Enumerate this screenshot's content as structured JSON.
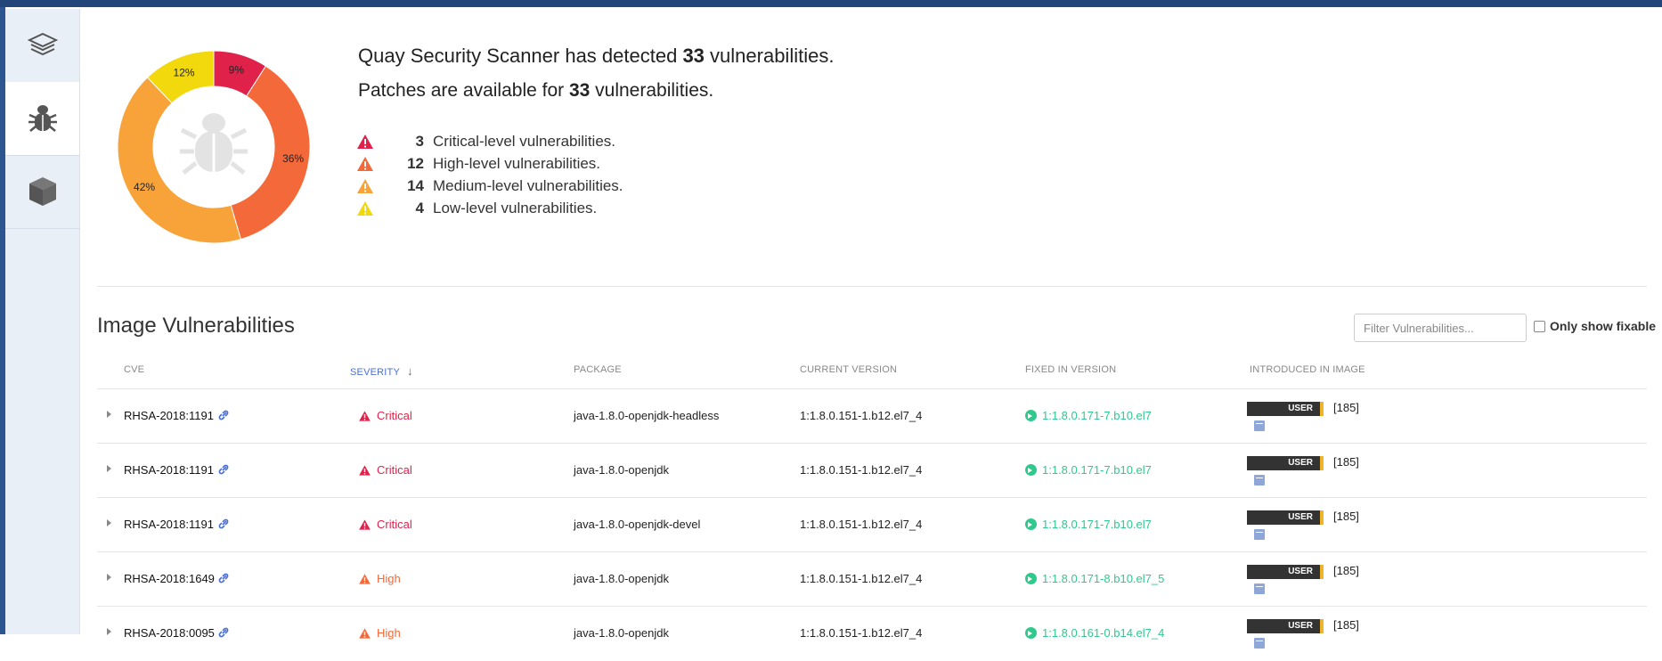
{
  "sidebar": {
    "tabs": [
      {
        "name": "layers",
        "icon": "layers-icon",
        "active": false
      },
      {
        "name": "security",
        "icon": "bug-icon",
        "active": true
      },
      {
        "name": "packages",
        "icon": "package-icon",
        "active": false
      }
    ]
  },
  "summary": {
    "line1_prefix": "Quay Security Scanner has detected ",
    "line1_count": "33",
    "line1_suffix": " vulnerabilities.",
    "line2_prefix": "Patches are available for ",
    "line2_count": "33",
    "line2_suffix": " vulnerabilities.",
    "levels": [
      {
        "count": "3",
        "label": "Critical-level vulnerabilities.",
        "color": "#e0224a"
      },
      {
        "count": "12",
        "label": "High-level vulnerabilities.",
        "color": "#f4693a"
      },
      {
        "count": "14",
        "label": "Medium-level vulnerabilities.",
        "color": "#f8a33a"
      },
      {
        "count": "4",
        "label": "Low-level vulnerabilities.",
        "color": "#f2d90e"
      }
    ]
  },
  "chart_data": {
    "type": "pie",
    "categories": [
      "Critical",
      "High",
      "Medium",
      "Low"
    ],
    "values": [
      3,
      12,
      14,
      4
    ],
    "labels": [
      "9%",
      "36%",
      "42%",
      "12%"
    ],
    "colors": [
      "#e0224a",
      "#f4693a",
      "#f8a33a",
      "#f2d90e"
    ],
    "center_icon": "bug-icon"
  },
  "vulnerabilities": {
    "title": "Image Vulnerabilities",
    "filter_placeholder": "Filter Vulnerabilities...",
    "only_fixable_label": "Only show fixable",
    "columns": [
      "CVE",
      "SEVERITY",
      "PACKAGE",
      "CURRENT VERSION",
      "FIXED IN VERSION",
      "INTRODUCED IN IMAGE"
    ],
    "sort_arrow": "↓",
    "rows": [
      {
        "cve": "RHSA-2018:1191",
        "severity": "Critical",
        "severity_color": "#e0224a",
        "package": "java-1.8.0-openjdk-headless",
        "current": "1:1.8.0.151-1.b12.el7_4",
        "fixed": "1:1.8.0.171-7.b10.el7",
        "badge": "USER",
        "image": "[185]"
      },
      {
        "cve": "RHSA-2018:1191",
        "severity": "Critical",
        "severity_color": "#e0224a",
        "package": "java-1.8.0-openjdk",
        "current": "1:1.8.0.151-1.b12.el7_4",
        "fixed": "1:1.8.0.171-7.b10.el7",
        "badge": "USER",
        "image": "[185]"
      },
      {
        "cve": "RHSA-2018:1191",
        "severity": "Critical",
        "severity_color": "#e0224a",
        "package": "java-1.8.0-openjdk-devel",
        "current": "1:1.8.0.151-1.b12.el7_4",
        "fixed": "1:1.8.0.171-7.b10.el7",
        "badge": "USER",
        "image": "[185]"
      },
      {
        "cve": "RHSA-2018:1649",
        "severity": "High",
        "severity_color": "#f4693a",
        "package": "java-1.8.0-openjdk",
        "current": "1:1.8.0.151-1.b12.el7_4",
        "fixed": "1:1.8.0.171-8.b10.el7_5",
        "badge": "USER",
        "image": "[185]"
      },
      {
        "cve": "RHSA-2018:0095",
        "severity": "High",
        "severity_color": "#f4693a",
        "package": "java-1.8.0-openjdk",
        "current": "1:1.8.0.151-1.b12.el7_4",
        "fixed": "1:1.8.0.161-0.b14.el7_4",
        "badge": "USER",
        "image": "[185]"
      }
    ]
  }
}
